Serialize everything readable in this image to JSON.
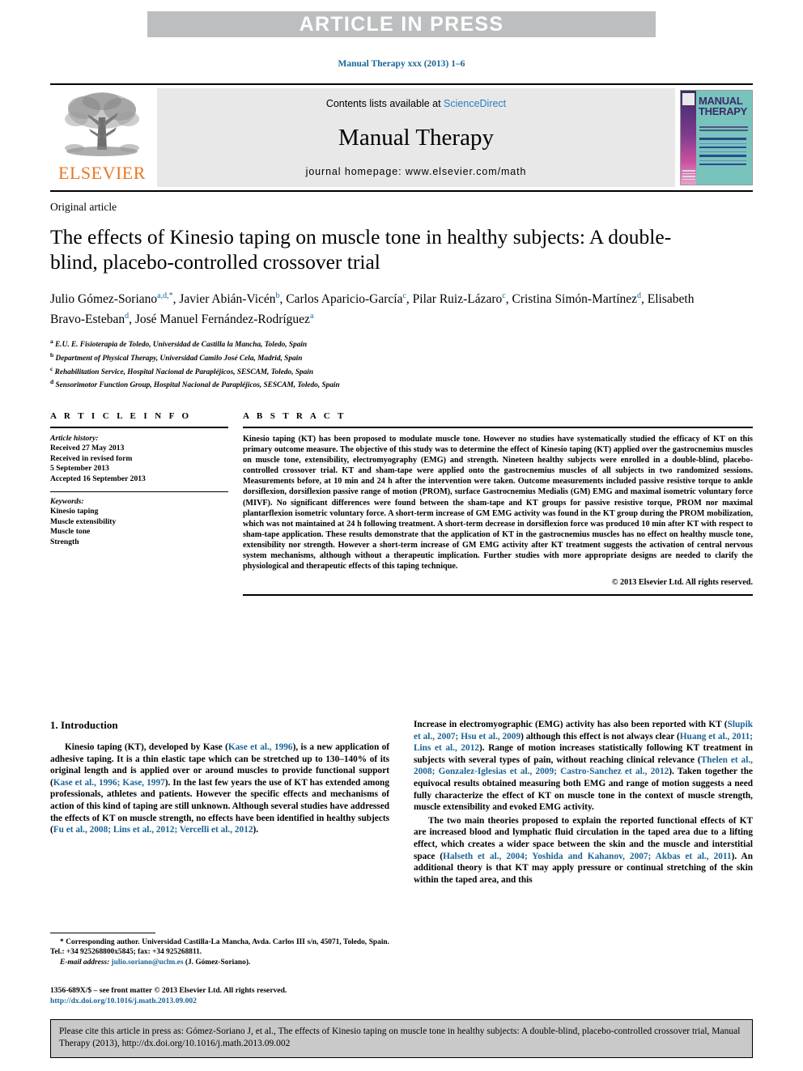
{
  "banner": {
    "text": "ARTICLE IN PRESS"
  },
  "journal_ref": "Manual Therapy xxx (2013) 1–6",
  "masthead": {
    "contents_prefix": "Contents lists available at ",
    "sciencedirect": "ScienceDirect",
    "journal_title": "Manual Therapy",
    "homepage": "journal homepage: www.elsevier.com/math",
    "publisher_wordmark": "ELSEVIER",
    "cover_title_line1": "MANUAL",
    "cover_title_line2": "THERAPY"
  },
  "article": {
    "type": "Original article",
    "title": "The effects of Kinesio taping on muscle tone in healthy subjects: A double-blind, placebo-controlled crossover trial",
    "authors": [
      {
        "name": "Julio Gómez-Soriano",
        "marks": "a,d,*",
        "sep": ", "
      },
      {
        "name": "Javier Abián-Vicén",
        "marks": "b",
        "sep": ", "
      },
      {
        "name": "Carlos Aparicio-García",
        "marks": "c",
        "sep": ", "
      },
      {
        "name": "Pilar Ruiz-Lázaro",
        "marks": "c",
        "sep": ", "
      },
      {
        "name": "Cristina Simón-Martínez",
        "marks": "d",
        "sep": ", "
      },
      {
        "name": "Elisabeth Bravo-Esteban",
        "marks": "d",
        "sep": ", "
      },
      {
        "name": "José Manuel Fernández-Rodríguez",
        "marks": "a",
        "sep": ""
      }
    ],
    "affiliations": [
      {
        "mark": "a",
        "text": "E.U. E. Fisioterapia de Toledo, Universidad de Castilla la Mancha, Toledo, Spain"
      },
      {
        "mark": "b",
        "text": "Department of Physical Therapy, Universidad Camilo José Cela, Madrid, Spain"
      },
      {
        "mark": "c",
        "text": "Rehabilitation Service, Hospital Nacional de Parapléjicos, SESCAM, Toledo, Spain"
      },
      {
        "mark": "d",
        "text": "Sensorimotor Function Group, Hospital Nacional de Parapléjicos, SESCAM, Toledo, Spain"
      }
    ]
  },
  "article_info": {
    "heading": "A R T I C L E  I N F O",
    "history_label": "Article history:",
    "history": [
      "Received 27 May 2013",
      "Received in revised form",
      "5 September 2013",
      "Accepted 16 September 2013"
    ],
    "keywords_label": "Keywords:",
    "keywords": [
      "Kinesio taping",
      "Muscle extensibility",
      "Muscle tone",
      "Strength"
    ]
  },
  "abstract": {
    "heading": "A B S T R A C T",
    "text": "Kinesio taping (KT) has been proposed to modulate muscle tone. However no studies have systematically studied the efficacy of KT on this primary outcome measure. The objective of this study was to determine the effect of Kinesio taping (KT) applied over the gastrocnemius muscles on muscle tone, extensibility, electromyography (EMG) and strength. Nineteen healthy subjects were enrolled in a double-blind, placebo-controlled crossover trial. KT and sham-tape were applied onto the gastrocnemius muscles of all subjects in two randomized sessions. Measurements before, at 10 min and 24 h after the intervention were taken. Outcome measurements included passive resistive torque to ankle dorsiflexion, dorsiflexion passive range of motion (PROM), surface Gastrocnemius Medialis (GM) EMG and maximal isometric voluntary force (MIVF). No significant differences were found between the sham-tape and KT groups for passive resistive torque, PROM nor maximal plantarflexion isometric voluntary force. A short-term increase of GM EMG activity was found in the KT group during the PROM mobilization, which was not maintained at 24 h following treatment. A short-term decrease in dorsiflexion force was produced 10 min after KT with respect to sham-tape application. These results demonstrate that the application of KT in the gastrocnemius muscles has no effect on healthy muscle tone, extensibility nor strength. However a short-term increase of GM EMG activity after KT treatment suggests the activation of central nervous system mechanisms, although without a therapeutic implication. Further studies with more appropriate designs are needed to clarify the physiological and therapeutic effects of this taping technique.",
    "copyright": "© 2013 Elsevier Ltd. All rights reserved."
  },
  "introduction": {
    "section_number_title": "1.  Introduction",
    "left_paragraph_1": {
      "t1": "Kinesio taping (KT), developed by Kase (",
      "c1": "Kase et al., 1996",
      "t2": "), is a new application of adhesive taping. It is a thin elastic tape which can be stretched up to 130–140% of its original length and is applied over or around muscles to provide functional support (",
      "c2": "Kase et al., 1996; Kase, 1997",
      "t3": "). In the last few years the use of KT has extended among professionals, athletes and patients. However the specific effects and mechanisms of action of this kind of taping are still unknown. Although several studies have addressed the effects of KT on muscle strength, no effects have been identified in healthy subjects (",
      "c3": "Fu et al., 2008; Lins et al., 2012; Vercelli et al., 2012",
      "t4": ")."
    },
    "right_paragraph_1": {
      "t1": "Increase in electromyographic (EMG) activity has also been reported with KT (",
      "c1": "Slupik et al., 2007; Hsu et al., 2009",
      "t2": ") although this effect is not always clear (",
      "c2": "Huang et al., 2011; Lins et al., 2012",
      "t3": "). Range of motion increases statistically following KT treatment in subjects with several types of pain, without reaching clinical relevance (",
      "c3": "Thelen et al., 2008; Gonzalez-Iglesias et al., 2009; Castro-Sanchez et al., 2012",
      "t4": "). Taken together the equivocal results obtained measuring both EMG and range of motion suggests a need fully characterize the effect of KT on muscle tone in the context of muscle strength, muscle extensibility and evoked EMG activity."
    },
    "right_paragraph_2": {
      "t1": "The two main theories proposed to explain the reported functional effects of KT are increased blood and lymphatic fluid circulation in the taped area due to a lifting effect, which creates a wider space between the skin and the muscle and interstitial space (",
      "c1": "Halseth et al., 2004; Yoshida and Kahanov, 2007; Akbas et al., 2011",
      "t2": "). An additional theory is that KT may apply pressure or continual stretching of the skin within the taped area, and this"
    }
  },
  "footnote": {
    "corresponding": "* Corresponding author. Universidad Castilla-La Mancha, Avda. Carlos III s/n, 45071, Toledo, Spain. Tel.: +34 925268800x5845; fax: +34 925268811.",
    "email_label": "E-mail address:",
    "email": "julio.soriano@uclm.es",
    "email_owner": "(J. Gómez-Soriano)."
  },
  "frontmatter": {
    "issn_line": "1356-689X/$ – see front matter © 2013 Elsevier Ltd. All rights reserved.",
    "doi": "http://dx.doi.org/10.1016/j.math.2013.09.002"
  },
  "citation_box": {
    "text": "Please cite this article in press as: Gómez-Soriano J, et al., The effects of Kinesio taping on muscle tone in healthy subjects: A double-blind, placebo-controlled crossover trial, Manual Therapy (2013), http://dx.doi.org/10.1016/j.math.2013.09.002"
  },
  "colors": {
    "link_blue": "#1a6496",
    "banner_gray": "#bcbec0",
    "elsevier_orange": "#e87722",
    "cite_box_gray": "#c9c9c9"
  }
}
